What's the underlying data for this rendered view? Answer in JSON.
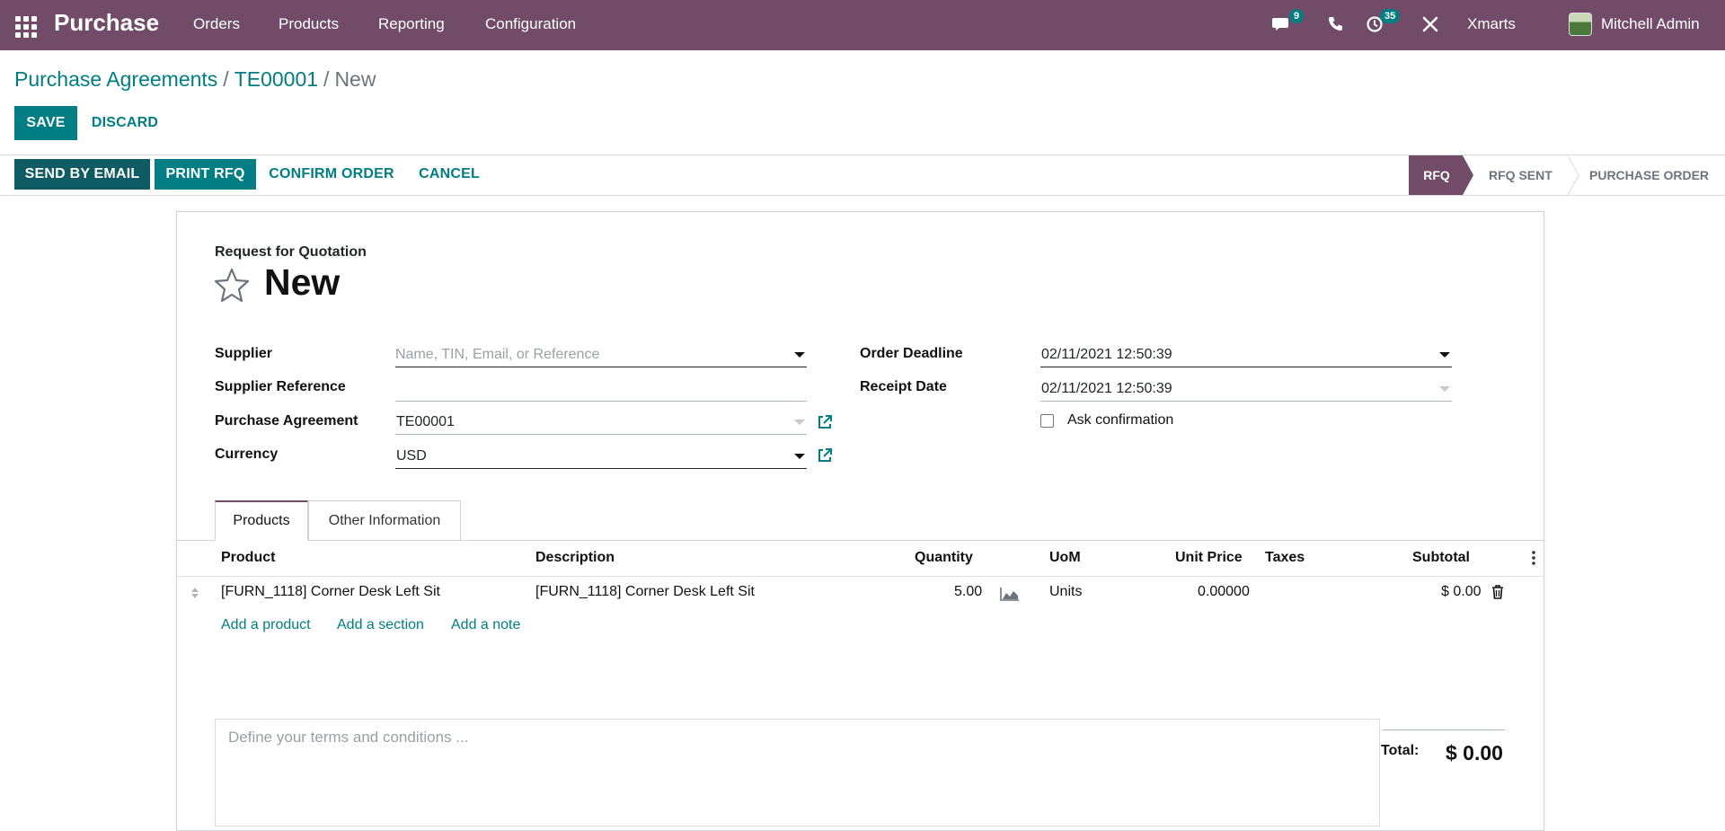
{
  "navbar": {
    "app_name": "Purchase",
    "menu": [
      "Orders",
      "Products",
      "Reporting",
      "Configuration"
    ],
    "messages_badge": "9",
    "activities_badge": "35",
    "company": "Xmarts",
    "user": "Mitchell Admin",
    "icons": [
      "apps-grid-icon",
      "chat-icon",
      "phone-icon",
      "clock-icon",
      "tools-icon"
    ]
  },
  "breadcrumb": {
    "items": [
      "Purchase Agreements",
      "TE00001"
    ],
    "separator": "/",
    "current": "New"
  },
  "actions": {
    "save": "SAVE",
    "discard": "DISCARD"
  },
  "toolbar": {
    "send_email": "SEND BY EMAIL",
    "print_rfq": "PRINT RFQ",
    "confirm_order": "CONFIRM ORDER",
    "cancel": "CANCEL"
  },
  "status": {
    "stages": [
      "RFQ",
      "RFQ SENT",
      "PURCHASE ORDER"
    ],
    "active": "RFQ"
  },
  "form": {
    "subtitle": "Request for Quotation",
    "title": "New",
    "supplier_label": "Supplier",
    "supplier_placeholder": "Name, TIN, Email, or Reference",
    "supplier_ref_label": "Supplier Reference",
    "supplier_ref_value": "",
    "agreement_label": "Purchase Agreement",
    "agreement_value": "TE00001",
    "currency_label": "Currency",
    "currency_value": "USD",
    "deadline_label": "Order Deadline",
    "deadline_value": "02/11/2021 12:50:39",
    "receipt_label": "Receipt Date",
    "receipt_value": "02/11/2021 12:50:39",
    "ask_confirmation": "Ask confirmation"
  },
  "tabs": [
    "Products",
    "Other Information"
  ],
  "table": {
    "columns": [
      "Product",
      "Description",
      "Quantity",
      "UoM",
      "Unit Price",
      "Taxes",
      "Subtotal"
    ],
    "rows": [
      {
        "product": "[FURN_1118] Corner Desk Left Sit",
        "description": "[FURN_1118] Corner Desk Left Sit",
        "quantity": "5.00",
        "uom": "Units",
        "unit_price": "0.00000",
        "taxes": "",
        "subtotal": "$ 0.00"
      }
    ],
    "add_product": "Add a product",
    "add_section": "Add a section",
    "add_note": "Add a note"
  },
  "footer": {
    "terms_placeholder": "Define your terms and conditions ...",
    "total_label": "Total:",
    "total_value": "$ 0.00"
  },
  "colors": {
    "brand": "#714b67",
    "accent": "#017e84",
    "dark_accent": "#0e5b63"
  }
}
